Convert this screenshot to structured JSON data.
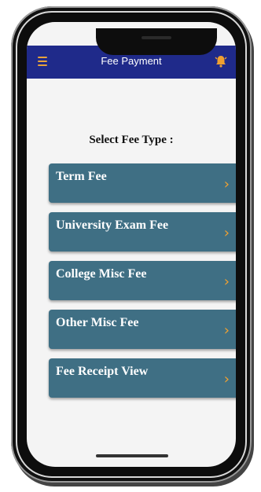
{
  "app": {
    "title": "Fee Payment",
    "menu_icon": "menu-icon",
    "notification_icon": "bell-icon",
    "header_color": "#1f2a8a",
    "accent_color": "#f0a030"
  },
  "main": {
    "section_title": "Select Fee Type :",
    "fee_types": [
      {
        "label": "Term Fee"
      },
      {
        "label": "University Exam Fee"
      },
      {
        "label": "College Misc Fee"
      },
      {
        "label": "Other Misc Fee"
      },
      {
        "label": "Fee Receipt View"
      }
    ],
    "button_color": "#3f6f84",
    "chevron_icon": "chevron-right-icon"
  }
}
